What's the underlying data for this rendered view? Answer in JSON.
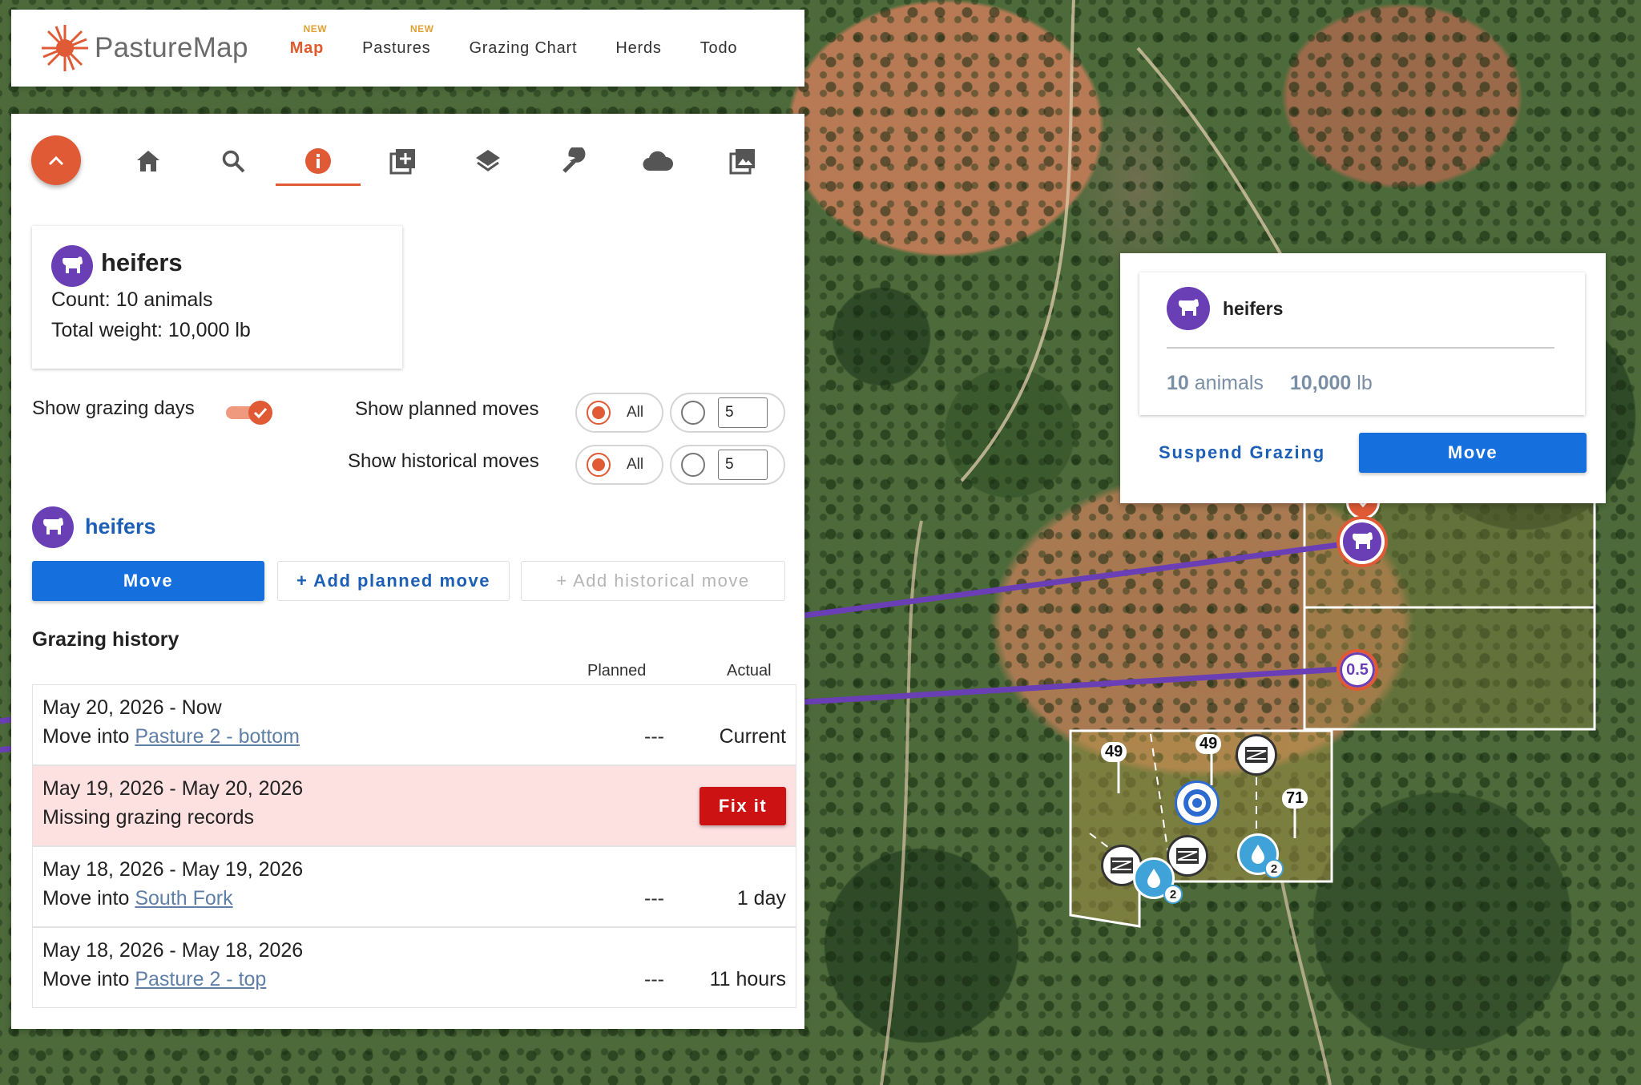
{
  "app": {
    "name": "PastureMap"
  },
  "nav": {
    "items": [
      {
        "label": "Map",
        "badge": "NEW",
        "active": true
      },
      {
        "label": "Pastures",
        "badge": "NEW",
        "active": false
      },
      {
        "label": "Grazing Chart",
        "badge": "",
        "active": false
      },
      {
        "label": "Herds",
        "badge": "",
        "active": false
      },
      {
        "label": "Todo",
        "badge": "",
        "active": false
      }
    ]
  },
  "toolbar": {
    "tools": [
      "home-icon",
      "search-icon",
      "info-icon",
      "add-layer-icon",
      "layers-icon",
      "wrench-icon",
      "cloud-icon",
      "image-icon"
    ],
    "active_tool": "info-icon"
  },
  "herd": {
    "name": "heifers",
    "count_line": "Count: 10 animals",
    "weight_line": "Total weight: 10,000 lb"
  },
  "options": {
    "show_grazing_days": {
      "label": "Show grazing days",
      "on": true
    },
    "planned_moves": {
      "label": "Show planned moves",
      "all_label": "All",
      "count_value": "5"
    },
    "historical_moves": {
      "label": "Show historical moves",
      "all_label": "All",
      "count_value": "5"
    }
  },
  "herd_section": {
    "name": "heifers",
    "move_label": "Move",
    "add_planned_label": "+ Add planned move",
    "add_historical_label": "+ Add historical move"
  },
  "history": {
    "title": "Grazing history",
    "col_planned": "Planned",
    "col_actual": "Actual",
    "rows": [
      {
        "dates": "May 20, 2026 - Now",
        "prefix": "Move into ",
        "pasture": "Pasture 2 - bottom",
        "planned": "---",
        "actual": "Current",
        "alert": false
      },
      {
        "dates": "May 19, 2026 - May 20, 2026",
        "message": "Missing grazing records",
        "action": "Fix it",
        "alert": true
      },
      {
        "dates": "May 18, 2026 - May 19, 2026",
        "prefix": "Move into ",
        "pasture": "South Fork",
        "planned": "---",
        "actual": "1 day",
        "alert": false
      },
      {
        "dates": "May 18, 2026 - May 18, 2026",
        "prefix": "Move into ",
        "pasture": "Pasture 2 - top",
        "planned": "---",
        "actual": "11 hours",
        "alert": false
      }
    ]
  },
  "popup": {
    "herd_name": "heifers",
    "animals_value": "10",
    "animals_unit": "animals",
    "weight_value": "10,000",
    "weight_unit": "lb",
    "suspend_label": "Suspend Grazing",
    "move_label": "Move"
  },
  "map": {
    "labels": [
      "0.5",
      "49",
      "49",
      "71",
      "2",
      "2"
    ]
  },
  "colors": {
    "brand": "#e05a35",
    "primary_button": "#1570de",
    "herd_purple": "#6a3fb5",
    "link_blue": "#1c5fb5",
    "alert_bg": "#fde1e1",
    "fix_button": "#cc1212"
  }
}
